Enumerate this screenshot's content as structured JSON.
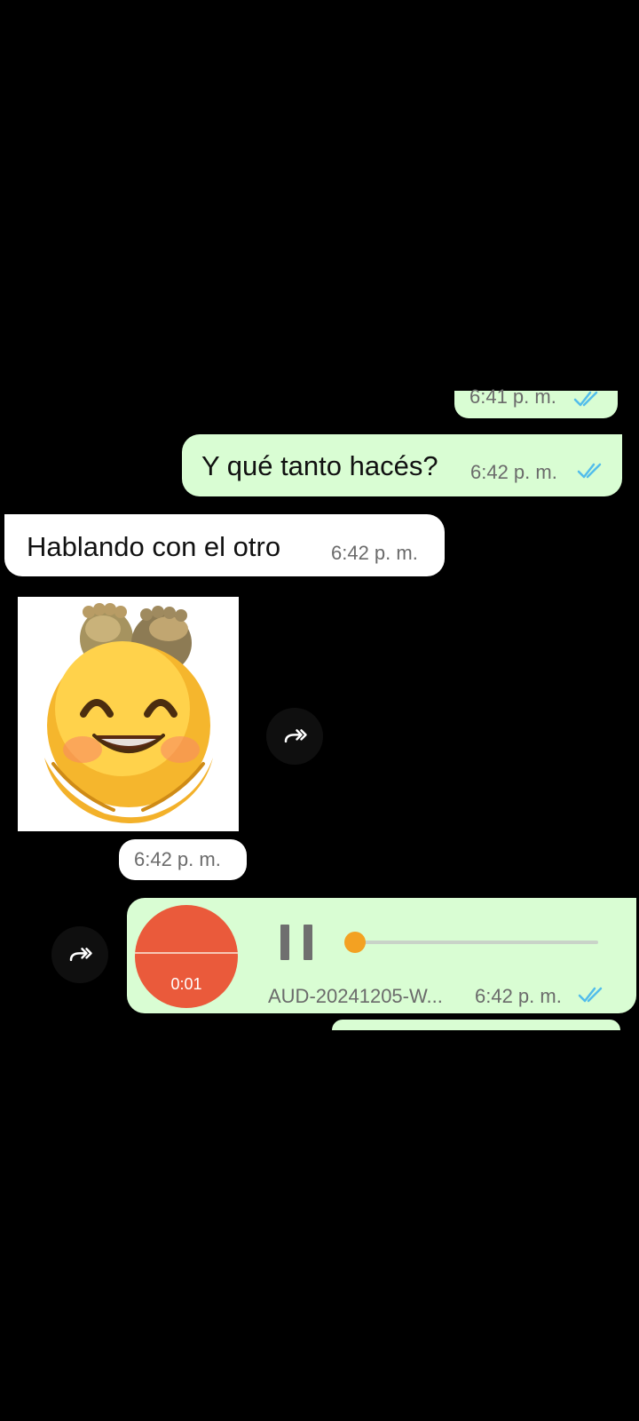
{
  "chat": {
    "messages": [
      {
        "time": "6:41 p. m."
      },
      {
        "text": "Y qué tanto hacés?",
        "time": "6:42 p. m."
      },
      {
        "text": "Hablando con el otro",
        "time": "6:42 p. m."
      },
      {
        "time": "6:42 p. m.",
        "icon": "sticker-image"
      },
      {
        "filename": "AUD-20241205-W...",
        "duration": "0:01",
        "time": "6:42 p. m.",
        "progress": 0.03
      }
    ]
  },
  "icons": {
    "forward": "forward-icon",
    "read_receipt": "double-check-icon",
    "pause": "pause-icon"
  },
  "colors": {
    "background": "#000000",
    "outgoing_bubble": "#d9fdd3",
    "incoming_bubble": "#ffffff",
    "read_tick": "#53bdeb",
    "audio_avatar": "#ea5a3b",
    "audio_progress": "#f3a122"
  }
}
